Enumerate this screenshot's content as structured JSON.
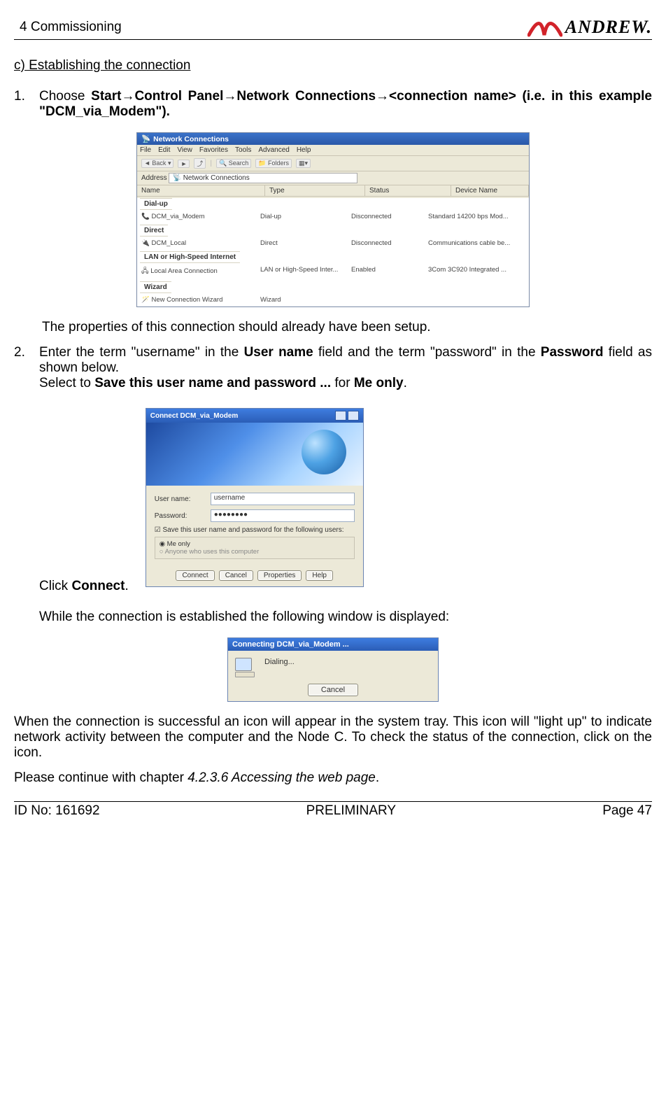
{
  "header": {
    "section": "4 Commissioning",
    "brand": "ANDREW."
  },
  "title": "c) Establishing the connection",
  "step1": {
    "num": "1.",
    "lead": "Choose ",
    "bold": "Start→Control Panel→Network Connections→<connection name> (i.e. in this example \"DCM_via_Modem\").",
    "note": "The properties of this connection should already have been setup."
  },
  "ncwin": {
    "title": "Network Connections",
    "menu": [
      "File",
      "Edit",
      "View",
      "Favorites",
      "Tools",
      "Advanced",
      "Help"
    ],
    "toolbar": {
      "back": "Back",
      "search": "Search",
      "folders": "Folders"
    },
    "addrLabel": "Address",
    "addrValue": "Network Connections",
    "cols": [
      "Name",
      "Type",
      "Status",
      "Device Name"
    ],
    "groups": [
      {
        "label": "Dial-up",
        "rows": [
          {
            "name": "DCM_via_Modem",
            "type": "Dial-up",
            "status": "Disconnected",
            "device": "Standard 14200 bps Mod..."
          }
        ]
      },
      {
        "label": "Direct",
        "rows": [
          {
            "name": "DCM_Local",
            "type": "Direct",
            "status": "Disconnected",
            "device": "Communications cable be..."
          }
        ]
      },
      {
        "label": "LAN or High-Speed Internet",
        "rows": [
          {
            "name": "Local Area Connection",
            "type": "LAN or High-Speed Inter...",
            "status": "Enabled",
            "device": "3Com 3C920 Integrated ..."
          }
        ]
      },
      {
        "label": "Wizard",
        "rows": [
          {
            "name": "New Connection Wizard",
            "type": "Wizard",
            "status": "",
            "device": ""
          }
        ]
      }
    ]
  },
  "step2": {
    "num": "2.",
    "l1a": "Enter the term \"username\" in the ",
    "l1b": "User name",
    "l1c": " field and the term \"password\" in the ",
    "l1d": "Password",
    "l1e": " field as shown below.",
    "l2a": "Select to ",
    "l2b": "Save this user name and password ...",
    "l2c": " for ",
    "l2d": "Me only",
    "l2e": "."
  },
  "connectDlg": {
    "title": "Connect DCM_via_Modem",
    "userLabel": "User name:",
    "userValue": "username",
    "passLabel": "Password:",
    "passValue": "●●●●●●●●",
    "saveChk": "Save this user name and password for the following users:",
    "opt1": "Me only",
    "opt2": "Anyone who uses this computer",
    "btnConnect": "Connect",
    "btnCancel": "Cancel",
    "btnProps": "Properties",
    "btnHelp": "Help"
  },
  "clickConnect": {
    "a": "Click ",
    "b": "Connect",
    "c": "."
  },
  "whileText": "While the connection is established the following window is displayed:",
  "connectingDlg": {
    "title": "Connecting DCM_via_Modem ...",
    "status": "Dialing...",
    "btnCancel": "Cancel"
  },
  "trayText": "When the connection is successful an icon will appear in the system tray. This icon will \"light up\" to indicate network activity between the computer and the Node C. To check the status of the connection, click on the icon.",
  "continueText": {
    "a": "Please continue with chapter ",
    "i": "4.2.3.6 Accessing the web page",
    "b": "."
  },
  "footer": {
    "id": "ID No: 161692",
    "center": "PRELIMINARY",
    "page": "Page 47"
  }
}
